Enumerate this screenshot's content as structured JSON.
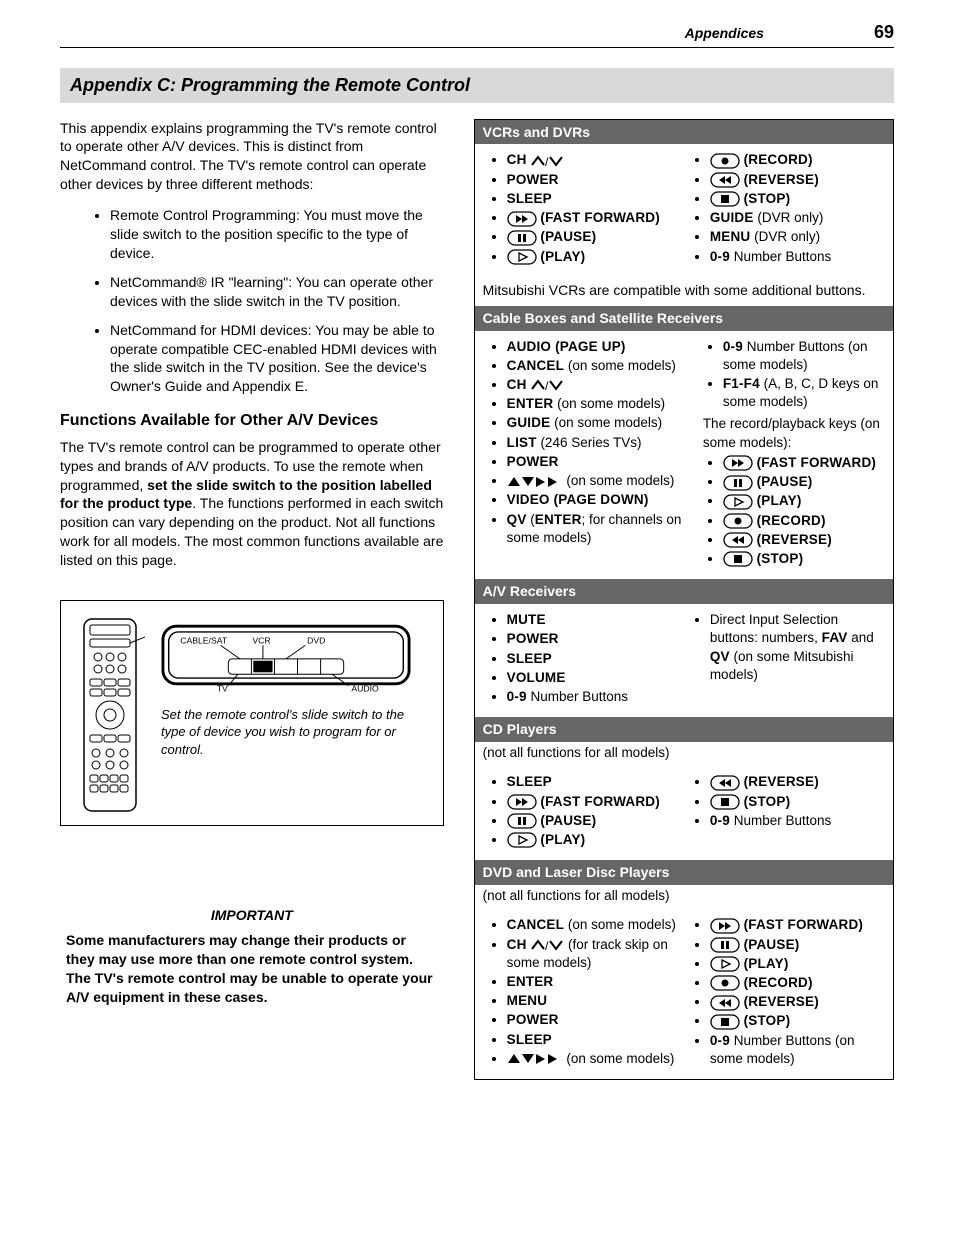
{
  "header": {
    "section": "Appendices",
    "page": "69"
  },
  "title": "Appendix C:  Programming the Remote Control",
  "intro": "This appendix explains programming the TV's remote control to operate other A/V devices.  This is distinct from NetCommand control.  The TV's remote control can operate other devices by three different methods:",
  "methods": [
    "Remote Control Programming:  You must move the slide switch to the position specific to the type of device.",
    "NetCommand® IR \"learning\":  You can operate other devices with the slide switch in the TV position.",
    "NetCommand for HDMI devices:  You may be able to operate compatible CEC-enabled HDMI devices with the slide switch in the TV position.  See the device's Owner's Guide and Appendix E."
  ],
  "functions_heading": "Functions Available for Other A/V Devices",
  "functions_para_pre": "The TV's remote control can be programmed to operate other types and brands of A/V products.  To use the remote when programmed, ",
  "functions_para_bold": "set the slide switch to the position labelled for the product type",
  "functions_para_post": ".  The functions performed in each switch position can vary depending on the product.  Not all functions work for all models.  The most common functions available are listed on this page.",
  "figure": {
    "labels": {
      "cablesat": "CABLE/SAT",
      "vcr": "VCR",
      "dvd": "DVD",
      "tv": "TV",
      "audio": "AUDIO"
    },
    "caption": "Set the remote control's slide switch to the type of device you wish to program for or control."
  },
  "important": {
    "title": "IMPORTANT",
    "body": "Some manufacturers may change their products or they may use more than one remote control system.  The TV's remote control may be unable to operate your A/V equipment in these cases."
  },
  "panels": {
    "vcr": {
      "title": "VCRs and DVRs",
      "left": [
        {
          "type": "ch"
        },
        {
          "type": "sc",
          "text": "POWER"
        },
        {
          "type": "sc",
          "text": "SLEEP"
        },
        {
          "type": "iconlabel",
          "icon": "ff",
          "label": "(FAST FORWARD)"
        },
        {
          "type": "iconlabel",
          "icon": "pause",
          "label": "(PAUSE)"
        },
        {
          "type": "iconlabel",
          "icon": "play",
          "label": "(PLAY)"
        }
      ],
      "right": [
        {
          "type": "iconlabel",
          "icon": "record",
          "label": "(RECORD)"
        },
        {
          "type": "iconlabel",
          "icon": "reverse",
          "label": "(REVERSE)"
        },
        {
          "type": "iconlabel",
          "icon": "stop",
          "label": "(STOP)"
        },
        {
          "type": "mixed",
          "sc": "GUIDE",
          "tail": " (DVR only)"
        },
        {
          "type": "mixed",
          "sc": "MENU",
          "tail": " (DVR only)"
        },
        {
          "type": "mixed",
          "sc": "0-9",
          "tail": " Number Buttons"
        }
      ],
      "note": "Mitsubishi VCRs are compatible with some additional buttons."
    },
    "cable": {
      "title": "Cable Boxes and Satellite Receivers",
      "left": [
        {
          "type": "sc",
          "text": "AUDIO (PAGE UP)"
        },
        {
          "type": "mixed",
          "sc": "CANCEL",
          "tail": " (on some models)"
        },
        {
          "type": "ch"
        },
        {
          "type": "mixed",
          "sc": "ENTER",
          "tail": " (on some models)"
        },
        {
          "type": "mixed",
          "sc": "GUIDE",
          "tail": " (on some models)"
        },
        {
          "type": "mixed",
          "sc": "LIST",
          "tail": " (246 Series TVs)"
        },
        {
          "type": "sc",
          "text": "POWER"
        },
        {
          "type": "arrows",
          "tail": " (on some models)"
        },
        {
          "type": "sc",
          "text": "VIDEO (PAGE DOWN)"
        },
        {
          "type": "qv"
        }
      ],
      "right_top": [
        {
          "type": "mixed",
          "sc": "0-9",
          "tail": " Number Buttons (on some models)"
        },
        {
          "type": "mixed",
          "sc": "F1-F4",
          "tail": " (A, B, C, D keys on some models)"
        }
      ],
      "right_note": "The record/playback keys (on some models):",
      "right_bottom": [
        {
          "type": "iconlabel",
          "icon": "ff",
          "label": "(FAST FORWARD)"
        },
        {
          "type": "iconlabel",
          "icon": "pause",
          "label": "(PAUSE)"
        },
        {
          "type": "iconlabel",
          "icon": "play",
          "label": "(PLAY)"
        },
        {
          "type": "iconlabel",
          "icon": "record",
          "label": "(RECORD)"
        },
        {
          "type": "iconlabel",
          "icon": "reverse",
          "label": "(REVERSE)"
        },
        {
          "type": "iconlabel",
          "icon": "stop",
          "label": "(STOP)"
        }
      ]
    },
    "av": {
      "title": "A/V Receivers",
      "left": [
        {
          "type": "sc",
          "text": "MUTE"
        },
        {
          "type": "sc",
          "text": "POWER"
        },
        {
          "type": "sc",
          "text": "SLEEP"
        },
        {
          "type": "sc",
          "text": "VOLUME"
        },
        {
          "type": "mixed",
          "sc": "0-9",
          "tail": " Number Buttons"
        }
      ],
      "right": [
        {
          "type": "direct"
        }
      ],
      "direct_text_pre": "Direct Input Selection buttons:  numbers, ",
      "direct_fav": "FAV",
      "direct_and": " and ",
      "direct_qv": "QV",
      "direct_tail": " (on some Mitsubishi models)"
    },
    "cd": {
      "title": "CD Players",
      "subnote": "(not all functions for all models)",
      "left": [
        {
          "type": "sc",
          "text": "SLEEP"
        },
        {
          "type": "iconlabel",
          "icon": "ff",
          "label": "(FAST FORWARD)"
        },
        {
          "type": "iconlabel",
          "icon": "pause",
          "label": "(PAUSE)"
        },
        {
          "type": "iconlabel",
          "icon": "play",
          "label": "(PLAY)"
        }
      ],
      "right": [
        {
          "type": "iconlabel",
          "icon": "reverse",
          "label": "(REVERSE)"
        },
        {
          "type": "iconlabel",
          "icon": "stop",
          "label": "(STOP)"
        },
        {
          "type": "mixed",
          "sc": "0-9",
          "tail": " Number Buttons"
        }
      ]
    },
    "dvd": {
      "title": "DVD and Laser Disc Players",
      "subnote": "(not all functions for all models)",
      "left": [
        {
          "type": "mixed",
          "sc": "CANCEL",
          "tail": " (on some models)"
        },
        {
          "type": "chtrack"
        },
        {
          "type": "sc",
          "text": "ENTER"
        },
        {
          "type": "sc",
          "text": "MENU"
        },
        {
          "type": "sc",
          "text": "POWER"
        },
        {
          "type": "sc",
          "text": "SLEEP"
        },
        {
          "type": "arrows",
          "tail": " (on some models)"
        }
      ],
      "right": [
        {
          "type": "iconlabel",
          "icon": "ff",
          "label": "(FAST FORWARD)"
        },
        {
          "type": "iconlabel",
          "icon": "pause",
          "label": "(PAUSE)"
        },
        {
          "type": "iconlabel",
          "icon": "play",
          "label": "(PLAY)"
        },
        {
          "type": "iconlabel",
          "icon": "record",
          "label": "(RECORD)"
        },
        {
          "type": "iconlabel",
          "icon": "reverse",
          "label": "(REVERSE)"
        },
        {
          "type": "iconlabel",
          "icon": "stop",
          "label": "(STOP)"
        },
        {
          "type": "mixed",
          "sc": "0-9",
          "tail": " Number Buttons (on some models)"
        }
      ]
    }
  },
  "glyphs": {
    "ch_label": "CH",
    "ch_track_tail": " (for track skip on some models)",
    "qv_pre": "QV",
    "qv_mid": " (",
    "qv_enter": "ENTER",
    "qv_post": "; for channels on some models)"
  }
}
